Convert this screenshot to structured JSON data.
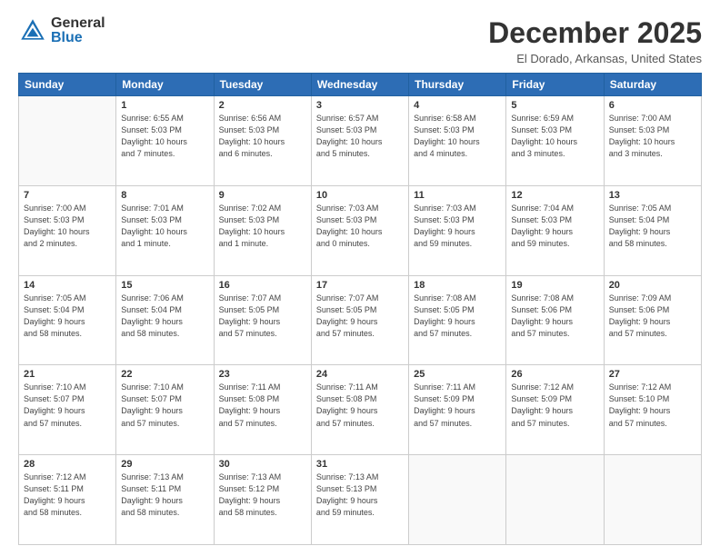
{
  "header": {
    "logo_general": "General",
    "logo_blue": "Blue",
    "month_title": "December 2025",
    "location": "El Dorado, Arkansas, United States"
  },
  "calendar": {
    "days_of_week": [
      "Sunday",
      "Monday",
      "Tuesday",
      "Wednesday",
      "Thursday",
      "Friday",
      "Saturday"
    ],
    "weeks": [
      [
        {
          "day": "",
          "info": ""
        },
        {
          "day": "1",
          "info": "Sunrise: 6:55 AM\nSunset: 5:03 PM\nDaylight: 10 hours\nand 7 minutes."
        },
        {
          "day": "2",
          "info": "Sunrise: 6:56 AM\nSunset: 5:03 PM\nDaylight: 10 hours\nand 6 minutes."
        },
        {
          "day": "3",
          "info": "Sunrise: 6:57 AM\nSunset: 5:03 PM\nDaylight: 10 hours\nand 5 minutes."
        },
        {
          "day": "4",
          "info": "Sunrise: 6:58 AM\nSunset: 5:03 PM\nDaylight: 10 hours\nand 4 minutes."
        },
        {
          "day": "5",
          "info": "Sunrise: 6:59 AM\nSunset: 5:03 PM\nDaylight: 10 hours\nand 3 minutes."
        },
        {
          "day": "6",
          "info": "Sunrise: 7:00 AM\nSunset: 5:03 PM\nDaylight: 10 hours\nand 3 minutes."
        }
      ],
      [
        {
          "day": "7",
          "info": "Sunrise: 7:00 AM\nSunset: 5:03 PM\nDaylight: 10 hours\nand 2 minutes."
        },
        {
          "day": "8",
          "info": "Sunrise: 7:01 AM\nSunset: 5:03 PM\nDaylight: 10 hours\nand 1 minute."
        },
        {
          "day": "9",
          "info": "Sunrise: 7:02 AM\nSunset: 5:03 PM\nDaylight: 10 hours\nand 1 minute."
        },
        {
          "day": "10",
          "info": "Sunrise: 7:03 AM\nSunset: 5:03 PM\nDaylight: 10 hours\nand 0 minutes."
        },
        {
          "day": "11",
          "info": "Sunrise: 7:03 AM\nSunset: 5:03 PM\nDaylight: 9 hours\nand 59 minutes."
        },
        {
          "day": "12",
          "info": "Sunrise: 7:04 AM\nSunset: 5:03 PM\nDaylight: 9 hours\nand 59 minutes."
        },
        {
          "day": "13",
          "info": "Sunrise: 7:05 AM\nSunset: 5:04 PM\nDaylight: 9 hours\nand 58 minutes."
        }
      ],
      [
        {
          "day": "14",
          "info": "Sunrise: 7:05 AM\nSunset: 5:04 PM\nDaylight: 9 hours\nand 58 minutes."
        },
        {
          "day": "15",
          "info": "Sunrise: 7:06 AM\nSunset: 5:04 PM\nDaylight: 9 hours\nand 58 minutes."
        },
        {
          "day": "16",
          "info": "Sunrise: 7:07 AM\nSunset: 5:05 PM\nDaylight: 9 hours\nand 57 minutes."
        },
        {
          "day": "17",
          "info": "Sunrise: 7:07 AM\nSunset: 5:05 PM\nDaylight: 9 hours\nand 57 minutes."
        },
        {
          "day": "18",
          "info": "Sunrise: 7:08 AM\nSunset: 5:05 PM\nDaylight: 9 hours\nand 57 minutes."
        },
        {
          "day": "19",
          "info": "Sunrise: 7:08 AM\nSunset: 5:06 PM\nDaylight: 9 hours\nand 57 minutes."
        },
        {
          "day": "20",
          "info": "Sunrise: 7:09 AM\nSunset: 5:06 PM\nDaylight: 9 hours\nand 57 minutes."
        }
      ],
      [
        {
          "day": "21",
          "info": "Sunrise: 7:10 AM\nSunset: 5:07 PM\nDaylight: 9 hours\nand 57 minutes."
        },
        {
          "day": "22",
          "info": "Sunrise: 7:10 AM\nSunset: 5:07 PM\nDaylight: 9 hours\nand 57 minutes."
        },
        {
          "day": "23",
          "info": "Sunrise: 7:11 AM\nSunset: 5:08 PM\nDaylight: 9 hours\nand 57 minutes."
        },
        {
          "day": "24",
          "info": "Sunrise: 7:11 AM\nSunset: 5:08 PM\nDaylight: 9 hours\nand 57 minutes."
        },
        {
          "day": "25",
          "info": "Sunrise: 7:11 AM\nSunset: 5:09 PM\nDaylight: 9 hours\nand 57 minutes."
        },
        {
          "day": "26",
          "info": "Sunrise: 7:12 AM\nSunset: 5:09 PM\nDaylight: 9 hours\nand 57 minutes."
        },
        {
          "day": "27",
          "info": "Sunrise: 7:12 AM\nSunset: 5:10 PM\nDaylight: 9 hours\nand 57 minutes."
        }
      ],
      [
        {
          "day": "28",
          "info": "Sunrise: 7:12 AM\nSunset: 5:11 PM\nDaylight: 9 hours\nand 58 minutes."
        },
        {
          "day": "29",
          "info": "Sunrise: 7:13 AM\nSunset: 5:11 PM\nDaylight: 9 hours\nand 58 minutes."
        },
        {
          "day": "30",
          "info": "Sunrise: 7:13 AM\nSunset: 5:12 PM\nDaylight: 9 hours\nand 58 minutes."
        },
        {
          "day": "31",
          "info": "Sunrise: 7:13 AM\nSunset: 5:13 PM\nDaylight: 9 hours\nand 59 minutes."
        },
        {
          "day": "",
          "info": ""
        },
        {
          "day": "",
          "info": ""
        },
        {
          "day": "",
          "info": ""
        }
      ]
    ]
  }
}
